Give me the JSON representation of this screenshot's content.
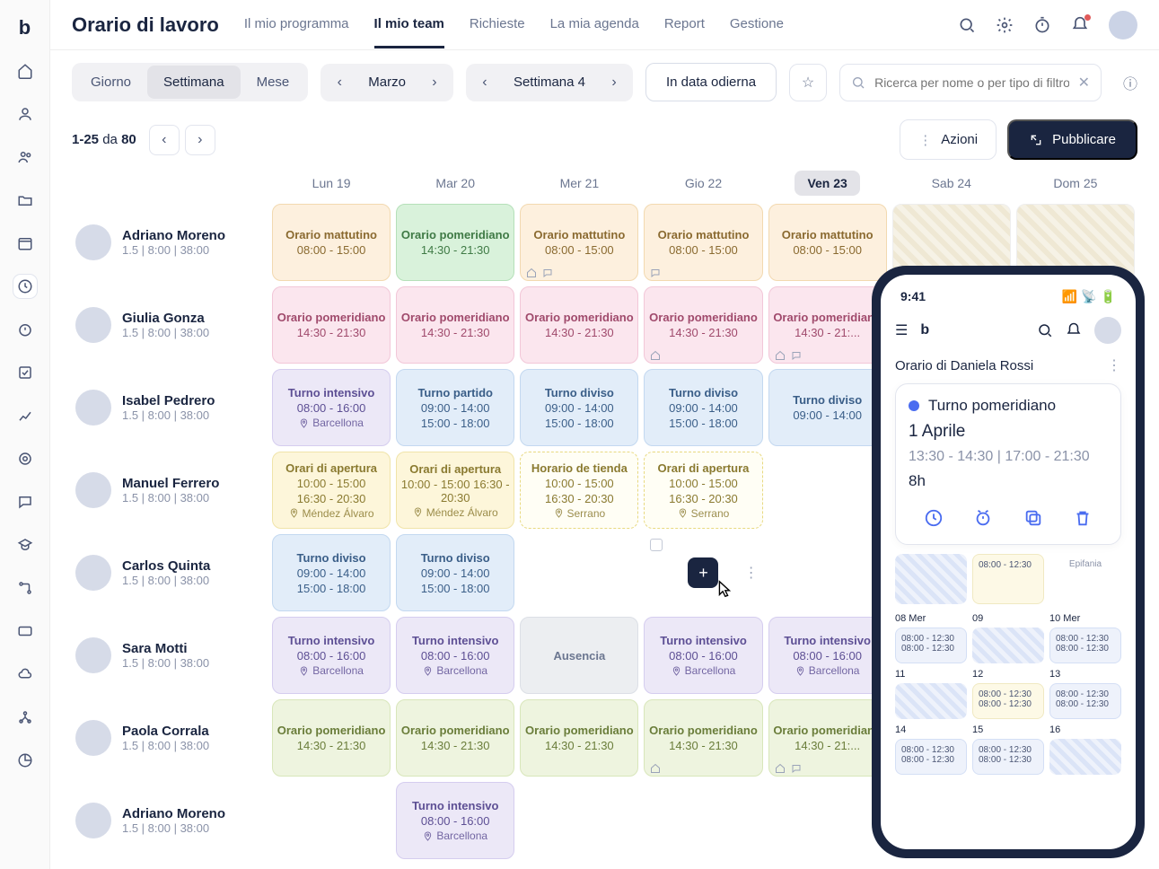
{
  "header": {
    "title": "Orario di lavoro",
    "tabs": [
      "Il mio programma",
      "Il mio team",
      "Richieste",
      "La mia agenda",
      "Report",
      "Gestione"
    ],
    "active_tab": 1
  },
  "controls": {
    "views": [
      "Giorno",
      "Settimana",
      "Mese"
    ],
    "active_view": 1,
    "month": "Marzo",
    "week": "Settimana 4",
    "today": "In data odierna",
    "search_placeholder": "Ricerca per nome o per tipo di filtro..."
  },
  "pager": {
    "range_from": "1-25",
    "da": "da",
    "total": "80"
  },
  "actions": {
    "actions": "Azioni",
    "publish": "Pubblicare"
  },
  "days": [
    "Lun 19",
    "Mar 20",
    "Mer 21",
    "Gio 22",
    "Ven 23",
    "Sab 24",
    "Dom 25"
  ],
  "current_day_index": 4,
  "employees": [
    {
      "name": "Adriano Moreno",
      "meta": "1.5 | 8:00 | 38:00",
      "shifts": [
        {
          "title": "Orario mattutino",
          "time": "08:00 - 15:00",
          "color": "orange"
        },
        {
          "title": "Orario pomeridiano",
          "time": "14:30 - 21:30",
          "color": "green"
        },
        {
          "title": "Orario mattutino",
          "time": "08:00 - 15:00",
          "color": "orange",
          "icons": [
            "home",
            "chat"
          ]
        },
        {
          "title": "Orario mattutino",
          "time": "08:00 - 15:00",
          "color": "orange",
          "icons": [
            "chat"
          ]
        },
        {
          "title": "Orario mattutino",
          "time": "08:00 - 15:00",
          "color": "orange"
        },
        {
          "hatched": true
        },
        {
          "hatched": true
        }
      ]
    },
    {
      "name": "Giulia Gonza",
      "meta": "1.5 | 8:00 | 38:00",
      "shifts": [
        {
          "title": "Orario pomeridiano",
          "time": "14:30 - 21:30",
          "color": "pink"
        },
        {
          "title": "Orario pomeridiano",
          "time": "14:30 - 21:30",
          "color": "pink"
        },
        {
          "title": "Orario pomeridiano",
          "time": "14:30 - 21:30",
          "color": "pink"
        },
        {
          "title": "Orario pomeridiano",
          "time": "14:30 - 21:30",
          "color": "pink",
          "icons": [
            "home"
          ]
        },
        {
          "title": "Orario pomeridiano",
          "time": "14:30 - 21:...",
          "color": "pink",
          "icons": [
            "home",
            "chat"
          ]
        },
        {},
        {}
      ]
    },
    {
      "name": "Isabel Pedrero",
      "meta": "1.5 | 8:00 | 38:00",
      "shifts": [
        {
          "title": "Turno intensivo",
          "time": "08:00 - 16:00",
          "loc": "Barcellona",
          "color": "purple"
        },
        {
          "title": "Turno partido",
          "time": "09:00 - 14:00",
          "time2": "15:00 - 18:00",
          "color": "blue"
        },
        {
          "title": "Turno diviso",
          "time": "09:00 - 14:00",
          "time2": "15:00 - 18:00",
          "color": "blue"
        },
        {
          "title": "Turno diviso",
          "time": "09:00 - 14:00",
          "time2": "15:00 - 18:00",
          "color": "blue"
        },
        {
          "title": "Turno diviso",
          "time": "09:00 - 14:00",
          "color": "blue"
        },
        {},
        {}
      ]
    },
    {
      "name": "Manuel Ferrero",
      "meta": "1.5 | 8:00 | 38:00",
      "shifts": [
        {
          "title": "Orari di apertura",
          "time": "10:00 - 15:00",
          "time2": "16:30 - 20:30",
          "loc": "Méndez Álvaro",
          "color": "yellow"
        },
        {
          "title": "Orari di apertura",
          "time": "10:00 - 15:00 16:30 - 20:30",
          "loc": "Méndez Álvaro",
          "color": "yellow"
        },
        {
          "title": "Horario de tienda",
          "time": "10:00 - 15:00",
          "time2": "16:30 - 20:30",
          "loc": "Serrano",
          "color": "yellow-d"
        },
        {
          "title": "Orari di apertura",
          "time": "10:00 - 15:00",
          "time2": "16:30 - 20:30",
          "loc": "Serrano",
          "color": "yellow-d"
        },
        {},
        {},
        {}
      ]
    },
    {
      "name": "Carlos Quinta",
      "meta": "1.5 | 8:00 | 38:00",
      "shifts": [
        {
          "title": "Turno diviso",
          "time": "09:00 - 14:00",
          "time2": "15:00 - 18:00",
          "color": "blue"
        },
        {
          "title": "Turno diviso",
          "time": "09:00 - 14:00",
          "time2": "15:00 - 18:00",
          "color": "blue"
        },
        {},
        {
          "add": true
        },
        {},
        {},
        {}
      ]
    },
    {
      "name": "Sara Motti",
      "meta": "1.5 | 8:00 | 38:00",
      "shifts": [
        {
          "title": "Turno intensivo",
          "time": "08:00 - 16:00",
          "loc": "Barcellona",
          "color": "purple"
        },
        {
          "title": "Turno intensivo",
          "time": "08:00 - 16:00",
          "loc": "Barcellona",
          "color": "purple"
        },
        {
          "title": "Ausencia",
          "color": "gray"
        },
        {
          "title": "Turno intensivo",
          "time": "08:00 - 16:00",
          "loc": "Barcellona",
          "color": "purple"
        },
        {
          "title": "Turno intensivo",
          "time": "08:00 - 16:00",
          "loc": "Barcellona",
          "color": "purple"
        },
        {},
        {}
      ]
    },
    {
      "name": "Paola Corrala",
      "meta": "1.5 | 8:00 | 38:00",
      "shifts": [
        {
          "title": "Orario pomeridiano",
          "time": "14:30 - 21:30",
          "color": "lime"
        },
        {
          "title": "Orario pomeridiano",
          "time": "14:30 - 21:30",
          "color": "lime"
        },
        {
          "title": "Orario pomeridiano",
          "time": "14:30 - 21:30",
          "color": "lime"
        },
        {
          "title": "Orario pomeridiano",
          "time": "14:30 - 21:30",
          "color": "lime",
          "icons": [
            "home"
          ]
        },
        {
          "title": "Orario pomeridiano",
          "time": "14:30 - 21:...",
          "color": "lime",
          "icons": [
            "home",
            "chat"
          ]
        },
        {},
        {}
      ]
    },
    {
      "name": "Adriano Moreno",
      "meta": "1.5 | 8:00 | 38:00",
      "shifts": [
        {},
        {
          "title": "Turno intensivo",
          "time": "08:00 - 16:00",
          "loc": "Barcellona",
          "color": "purple"
        },
        {},
        {},
        {},
        {},
        {}
      ]
    }
  ],
  "phone": {
    "time": "9:41",
    "title": "Orario di Daniela Rossi",
    "card": {
      "name": "Turno pomeridiano",
      "date": "1 Aprile",
      "time": "13:30 - 14:30 | 17:00 - 21:30",
      "dur": "8h"
    },
    "cal_top": [
      {
        "hatch": true
      },
      {
        "t1": "08:00 - 12:30",
        "box": "yel"
      },
      {
        "label": "Epifania"
      }
    ],
    "cal": [
      {
        "d": "08 Mer",
        "t1": "08:00 - 12:30",
        "t2": "08:00 - 12:30",
        "box": "blue"
      },
      {
        "d": "09",
        "hatch": true
      },
      {
        "d": "10 Mer",
        "t1": "08:00 - 12:30",
        "t2": "08:00 - 12:30",
        "box": "blue"
      },
      {
        "d": "11",
        "hatch": true
      },
      {
        "d": "12",
        "t1": "08:00 - 12:30",
        "t2": "08:00 - 12:30",
        "box": "yel"
      },
      {
        "d": "13",
        "t1": "08:00 - 12:30",
        "t2": "08:00 - 12:30",
        "box": "blue"
      },
      {
        "d": "14",
        "t1": "08:00 - 12:30",
        "t2": "08:00 - 12:30",
        "box": "blue"
      },
      {
        "d": "15",
        "t1": "08:00 - 12:30",
        "t2": "08:00 - 12:30",
        "box": "blue"
      },
      {
        "d": "16",
        "hatch": true
      }
    ]
  }
}
